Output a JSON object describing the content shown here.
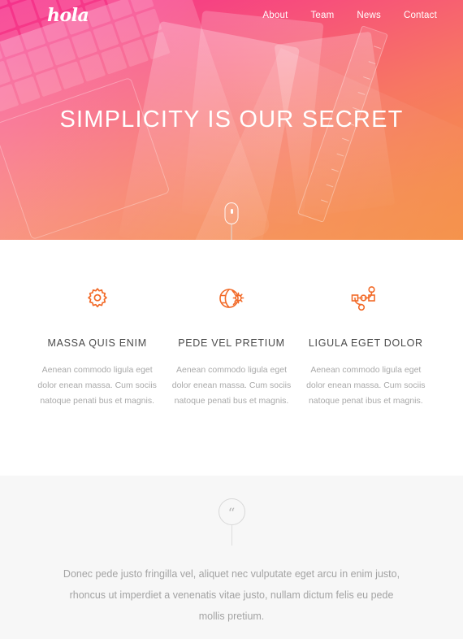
{
  "theme": {
    "gradient_start": "#f5318c",
    "gradient_end": "#f5924a",
    "icon_accent": "#f26a28",
    "heading_color": "#4a4a4a",
    "body_color": "#a9a9a9",
    "testimonial_bg": "#f7f7f7"
  },
  "header": {
    "logo": "hola",
    "nav": [
      {
        "label": "About"
      },
      {
        "label": "Team"
      },
      {
        "label": "News"
      },
      {
        "label": "Contact"
      }
    ]
  },
  "hero": {
    "title": "SIMPLICITY IS OUR SECRET",
    "scroll_indicator_icon": "mouse-scroll-icon"
  },
  "features": [
    {
      "icon": "gear-icon",
      "title": "MASSA QUIS ENIM",
      "text": "Aenean commodo ligula eget dolor enean massa. Cum sociis natoque penati bus et magnis."
    },
    {
      "icon": "globe-sun-icon",
      "title": "PEDE VEL PRETIUM",
      "text": "Aenean commodo ligula eget dolor enean massa. Cum sociis natoque penati bus et magnis."
    },
    {
      "icon": "bezier-path-icon",
      "title": "LIGULA EGET DOLOR",
      "text": "Aenean commodo ligula eget dolor enean massa. Cum sociis natoque penat ibus et magnis."
    }
  ],
  "testimonial": {
    "badge_icon": "quote-icon",
    "badge_glyph": "“",
    "text": "Donec pede justo fringilla vel, aliquet nec vulputate eget arcu in enim justo, rhoncus ut imperdiet a venenatis vitae justo, nullam dictum felis eu pede mollis pretium."
  }
}
